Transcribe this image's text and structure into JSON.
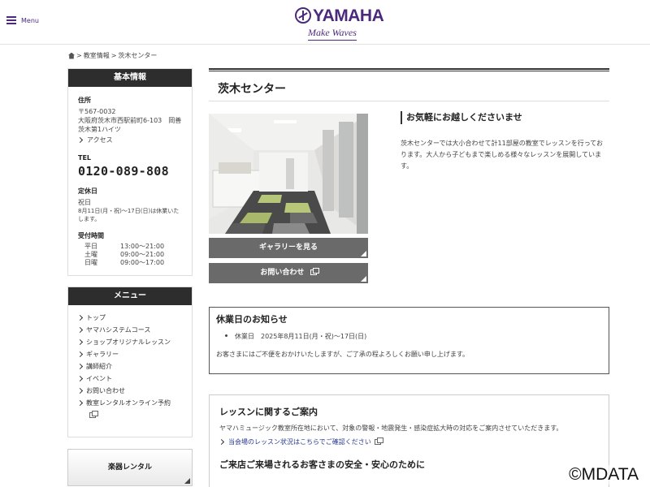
{
  "header": {
    "menu_label": "Menu",
    "logo_text": "YAMAHA",
    "logo_tagline": "Make Waves"
  },
  "breadcrumb": {
    "sep1": ">",
    "item1": "教室情報",
    "sep2": ">",
    "item2": "茨木センター"
  },
  "sidebar": {
    "info": {
      "heading": "基本情報",
      "address_label": "住所",
      "postal": "〒567-0032",
      "address": "大阪府茨木市西駅前町6-103　岡善茨木第1ハイツ",
      "access_label": "アクセス",
      "tel_label": "TEL",
      "tel": "0120-089-808",
      "holiday_label": "定休日",
      "holiday": "祝日",
      "holiday_note": "8月11日(月・祝)〜17日(日)は休業いたします。",
      "hours_label": "受付時間",
      "hours": [
        {
          "day": "平日",
          "time": "13:00〜21:00"
        },
        {
          "day": "土曜",
          "time": "09:00〜21:00"
        },
        {
          "day": "日曜",
          "time": "09:00〜17:00"
        }
      ]
    },
    "menu": {
      "heading": "メニュー",
      "items": [
        "トップ",
        "ヤマハシステムコース",
        "ショップオリジナルレッスン",
        "ギャラリー",
        "講師紹介",
        "イベント",
        "お問い合わせ",
        "教室レンタルオンライン予約"
      ]
    },
    "rental_label": "楽器レンタル"
  },
  "main": {
    "title": "茨木センター",
    "gallery_button": "ギャラリーを見る",
    "contact_button": "お問い合わせ",
    "welcome_heading": "お気軽にお越しくださいませ",
    "welcome_text": "茨木センターでは大小合わせて計11部屋の教室でレッスンを行っております。大人から子どもまで楽しめる様々なレッスンを展開しています。",
    "notice": {
      "title": "休業日のお知らせ",
      "item": "休業日　2025年8月11日(月・祝)〜17日(日)",
      "text": "お客さまにはご不便をおかけいたしますが、ご了承の程よろしくお願い申し上げます。"
    },
    "lesson": {
      "title": "レッスンに関するご案内",
      "text": "ヤマハミュージック教室所在地において、対象の警報・地震発生・感染症拡大時の対応をご案内させていただきます。",
      "link": "当会場のレッスン状況はこちらでご確認ください",
      "subtitle": "ご来店ご来場されるお客さまの安全・安心のために"
    }
  },
  "watermark": "©MDATA",
  "colors": {
    "brand": "#4b2a7b",
    "dark_header": "#2d2d2d",
    "button_gray": "#6a6a6a",
    "link_blue": "#2a3a8f"
  }
}
